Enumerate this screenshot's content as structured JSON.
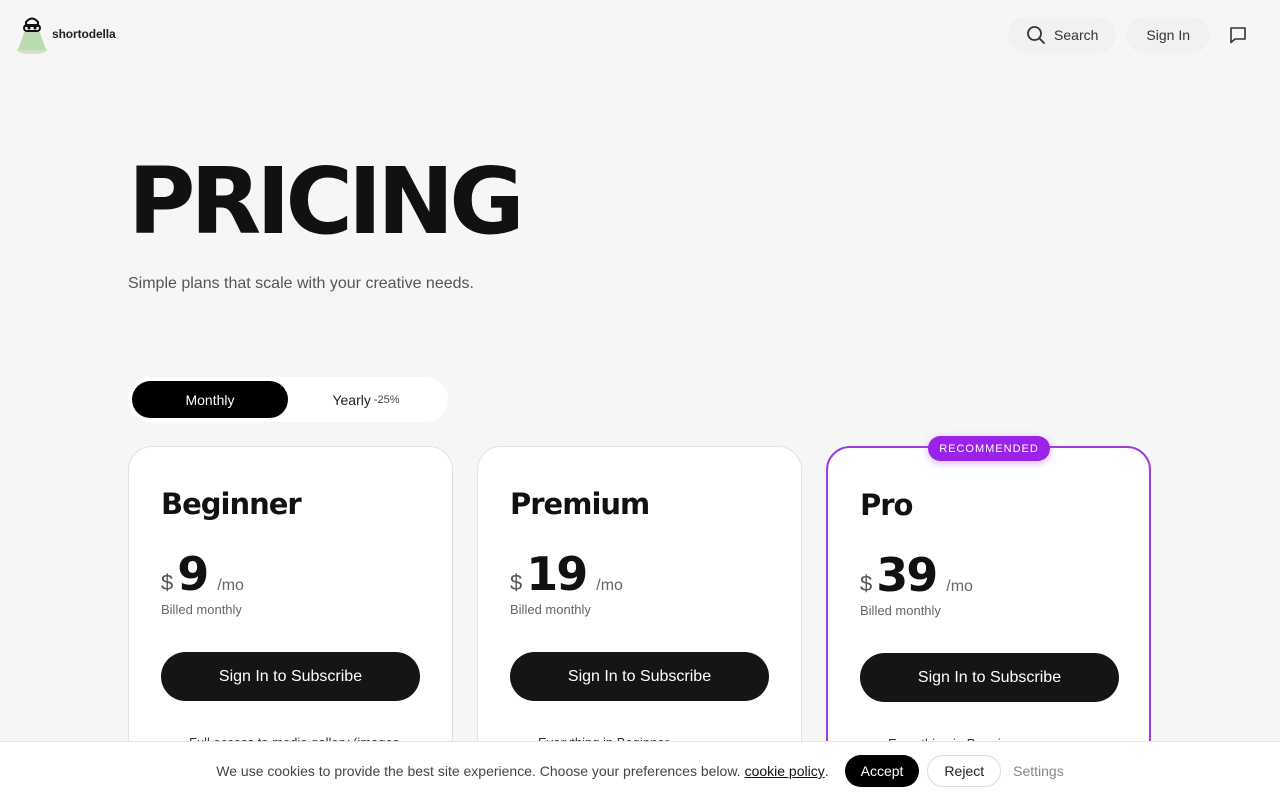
{
  "header": {
    "logo_text": "shortodella",
    "search_label": "Search",
    "signin_label": "Sign In"
  },
  "hero": {
    "title": "PRICING",
    "subtitle": "Simple plans that scale with your creative needs."
  },
  "toggle": {
    "monthly_label": "Monthly",
    "yearly_label": "Yearly",
    "yearly_badge": "-25%",
    "selected": "Monthly"
  },
  "recommended_badge": "RECOMMENDED",
  "plans": [
    {
      "name": "Beginner",
      "currency": "$",
      "amount": "9",
      "period": "/mo",
      "billed": "Billed monthly",
      "cta": "Sign In to Subscribe",
      "feature": "Full access to media gallery (images"
    },
    {
      "name": "Premium",
      "currency": "$",
      "amount": "19",
      "period": "/mo",
      "billed": "Billed monthly",
      "cta": "Sign In to Subscribe",
      "feature": "Everything in Beginner"
    },
    {
      "name": "Pro",
      "currency": "$",
      "amount": "39",
      "period": "/mo",
      "billed": "Billed monthly",
      "cta": "Sign In to Subscribe",
      "feature": "Everything in Premium"
    }
  ],
  "cookie": {
    "text": "We use cookies to provide the best site experience. Choose your preferences below.",
    "link": "cookie policy",
    "period_mark": ".",
    "accept": "Accept",
    "reject": "Reject",
    "settings": "Settings"
  },
  "colors": {
    "accent": "#9b22e8",
    "background": "#f6f6f6",
    "button_dark": "#151515"
  }
}
